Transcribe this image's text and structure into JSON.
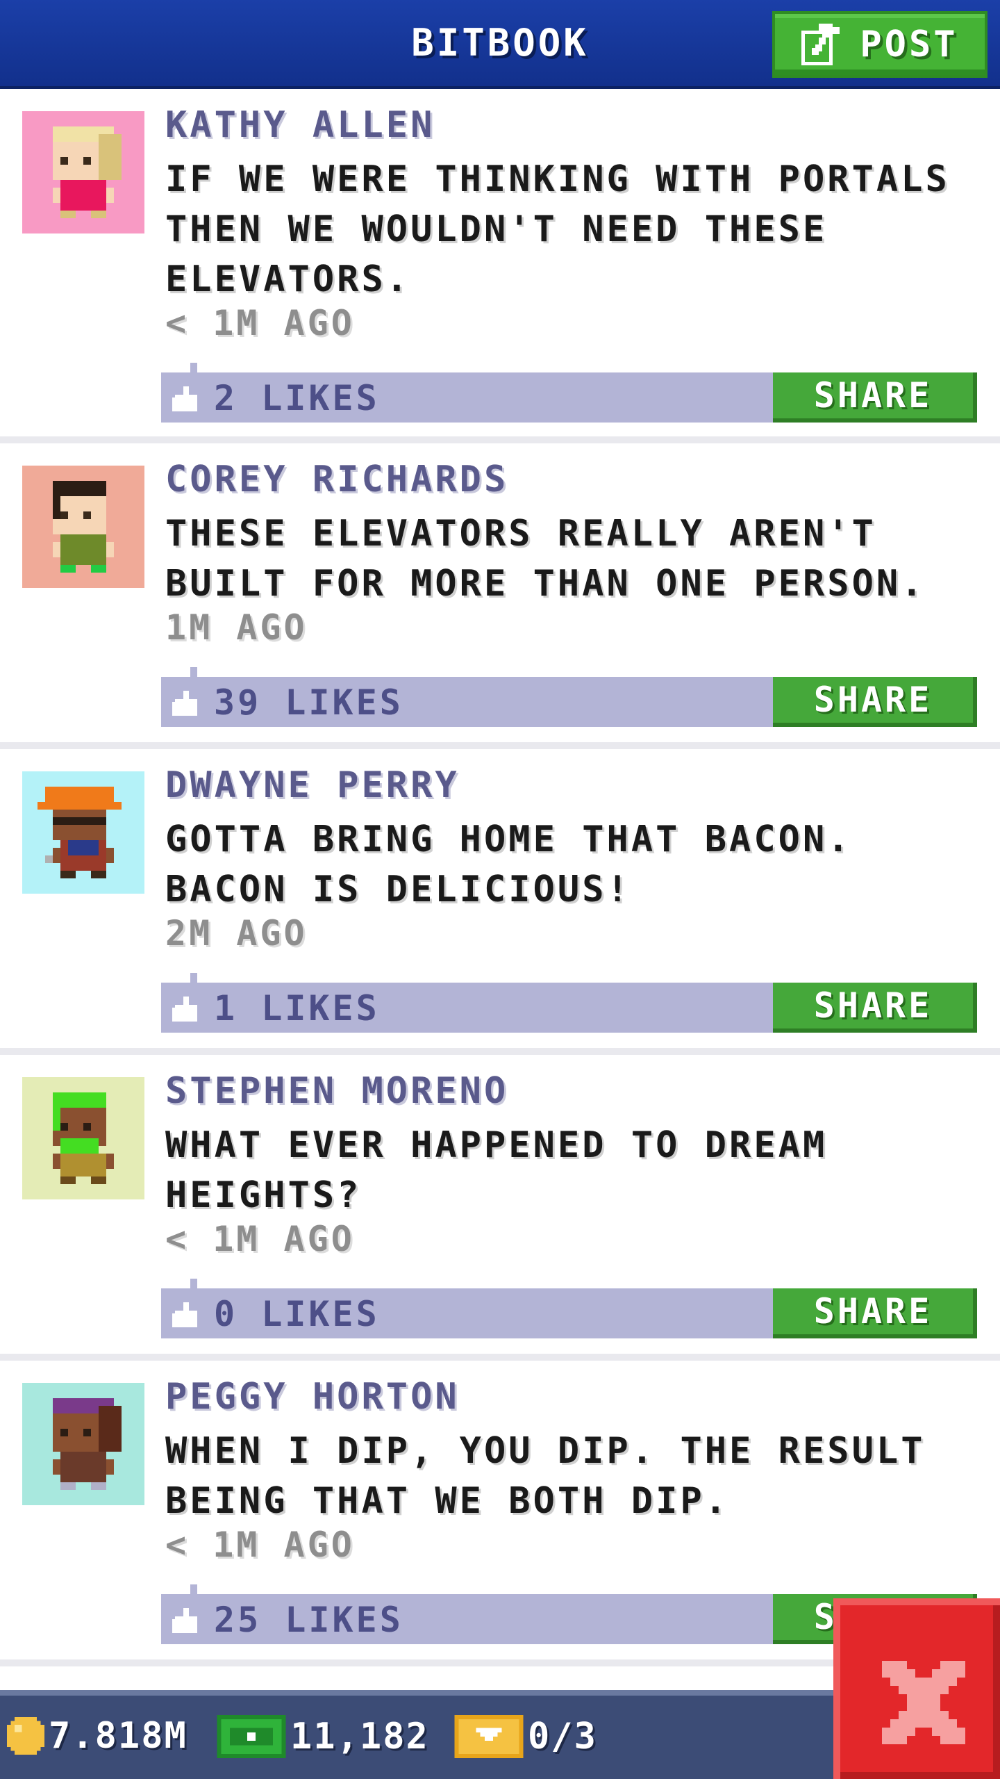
{
  "header": {
    "title": "BITBOOK",
    "post_label": "POST"
  },
  "posts": [
    {
      "author": "KATHY ALLEN",
      "message": "IF WE WERE THINKING WITH PORTALS THEN WE WOULDN'T NEED THESE ELEVATORS.",
      "time": "< 1M AGO",
      "likes": "2 LIKES",
      "share_label": "SHARE",
      "avatar_bg": "#f89ac4"
    },
    {
      "author": "COREY RICHARDS",
      "message": "THESE ELEVATORS REALLY AREN'T BUILT FOR MORE THAN ONE PERSON.",
      "time": "1M AGO",
      "likes": "39 LIKES",
      "share_label": "SHARE",
      "avatar_bg": "#f0aa98"
    },
    {
      "author": "DWAYNE PERRY",
      "message": "GOTTA BRING HOME THAT BACON. BACON IS DELICIOUS!",
      "time": "2M AGO",
      "likes": "1 LIKES",
      "share_label": "SHARE",
      "avatar_bg": "#b4f2f8"
    },
    {
      "author": "STEPHEN MORENO",
      "message": "WHAT EVER HAPPENED TO DREAM HEIGHTS?",
      "time": "< 1M AGO",
      "likes": "0 LIKES",
      "share_label": "SHARE",
      "avatar_bg": "#e4ecb6"
    },
    {
      "author": "PEGGY HORTON",
      "message": "WHEN I DIP, YOU DIP. THE RESULT BEING THAT WE BOTH DIP.",
      "time": "< 1M AGO",
      "likes": "25 LIKES",
      "share_label": "SHARE",
      "avatar_bg": "#a8e8de"
    }
  ],
  "status_bar": {
    "coins": "7.818M",
    "bux": "11,182",
    "tickets": "0/3"
  },
  "colors": {
    "header": "#1b3fa8",
    "accent_green": "#45b335",
    "like_bar": "#b3b4d6",
    "close_red": "#e3272a"
  }
}
